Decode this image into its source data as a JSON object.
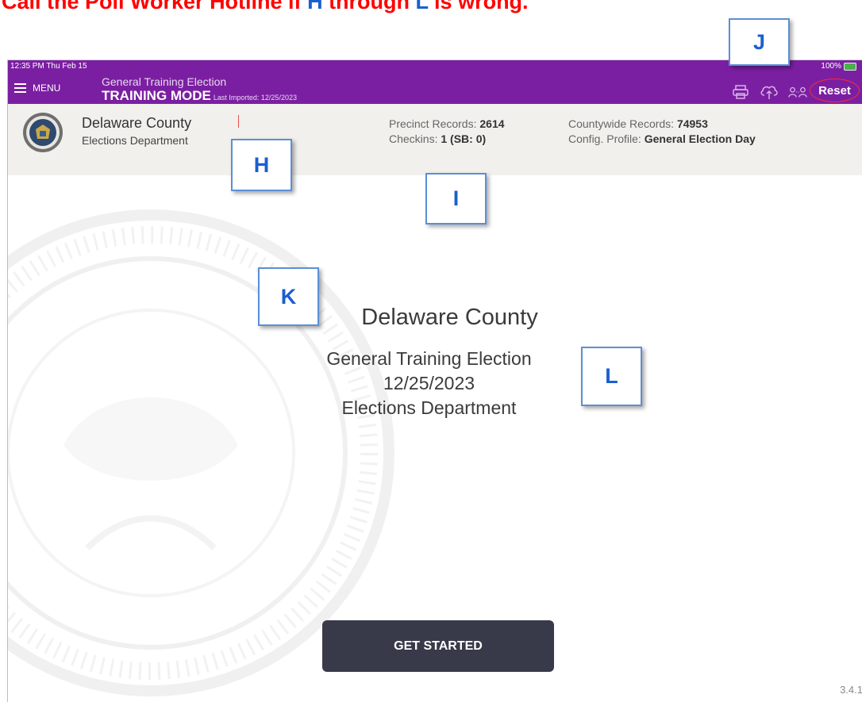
{
  "banner": {
    "line1": "Call the Poll Worker Hotline if ",
    "h": "H",
    "through": " through ",
    "l": "L",
    "rest": " is wrong."
  },
  "status": {
    "time": "12:35 PM  Thu Feb 15",
    "battery": "100%"
  },
  "header": {
    "menu_label": "MENU",
    "election_title": "General Training Election",
    "training_mode": "TRAINING MODE",
    "last_imported": "Last Imported: 12/25/2023",
    "reset_label": "Reset",
    "icons": [
      "printer-icon",
      "cloud-upload-icon",
      "people-icon"
    ]
  },
  "info": {
    "county": "Delaware County",
    "department": "Elections Department",
    "precinct_records_label": "Precinct Records: ",
    "precinct_records_value": "2614",
    "checkins_label": "Checkins: ",
    "checkins_value": "1 (SB: 0)",
    "countywide_records_label": "Countywide Records: ",
    "countywide_records_value": "74953",
    "config_profile_label": "Config. Profile: ",
    "config_profile_value": "General Election Day"
  },
  "main": {
    "county": "Delaware County",
    "election": "General Training Election",
    "date": "12/25/2023",
    "department": "Elections Department",
    "get_started": "GET STARTED",
    "version": "3.4.1"
  },
  "callouts": {
    "h": "H",
    "i": "I",
    "j": "J",
    "k": "K",
    "l": "L"
  },
  "colors": {
    "header_purple": "#7b1fa2",
    "info_bar": "#f1f0ec",
    "button_dark": "#383a4a",
    "callout_blue": "#1a5fcf",
    "banner_red": "#ff0000"
  }
}
